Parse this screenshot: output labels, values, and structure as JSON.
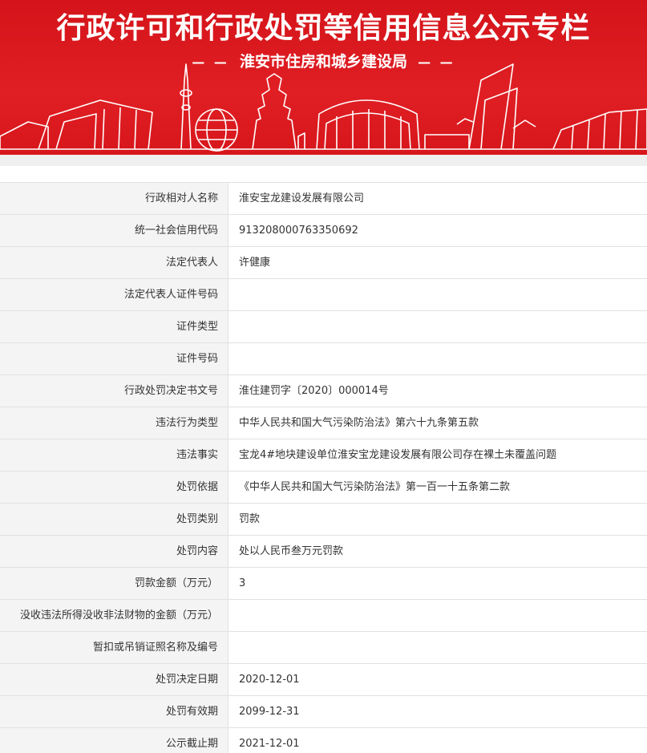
{
  "banner": {
    "title": "行政许可和行政处罚等信用信息公示专栏",
    "dash_left": "— —",
    "organization": "淮安市住房和城乡建设局",
    "dash_right": "— —"
  },
  "rows": [
    {
      "label": "行政相对人名称",
      "value": "淮安宝龙建设发展有限公司"
    },
    {
      "label": "统一社会信用代码",
      "value": "913208000763350692"
    },
    {
      "label": "法定代表人",
      "value": "许健康"
    },
    {
      "label": "法定代表人证件号码",
      "value": ""
    },
    {
      "label": "证件类型",
      "value": ""
    },
    {
      "label": "证件号码",
      "value": ""
    },
    {
      "label": "行政处罚决定书文号",
      "value": "淮住建罚字〔2020〕000014号"
    },
    {
      "label": "违法行为类型",
      "value": "中华人民共和国大气污染防治法》第六十九条第五款"
    },
    {
      "label": "违法事实",
      "value": "宝龙4#地块建设单位淮安宝龙建设发展有限公司存在裸土未覆盖问题"
    },
    {
      "label": "处罚依据",
      "value": "《中华人民共和国大气污染防治法》第一百一十五条第二款"
    },
    {
      "label": "处罚类别",
      "value": "罚款"
    },
    {
      "label": "处罚内容",
      "value": "处以人民币叁万元罚款"
    },
    {
      "label": "罚款金额（万元）",
      "value": "3"
    },
    {
      "label": "没收违法所得没收非法财物的金额（万元）",
      "value": ""
    },
    {
      "label": "暂扣或吊销证照名称及编号",
      "value": ""
    },
    {
      "label": "处罚决定日期",
      "value": "2020-12-01"
    },
    {
      "label": "处罚有效期",
      "value": "2099-12-31"
    },
    {
      "label": "公示截止期",
      "value": "2021-12-01"
    }
  ]
}
